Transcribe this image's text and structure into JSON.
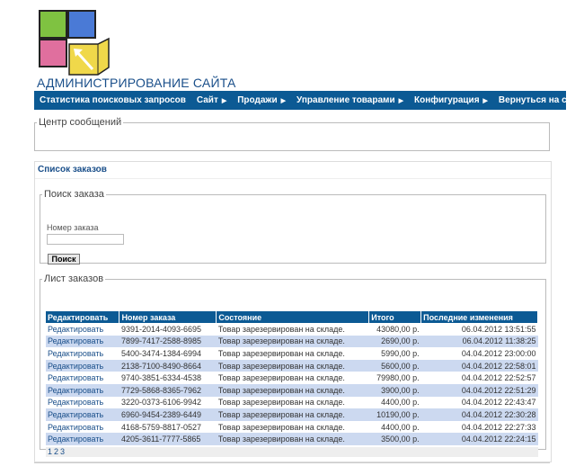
{
  "header": {
    "site_title": "АДМИНИСТРИРОВАНИЕ САЙТА",
    "logo_colors": [
      "#7fc241",
      "#4a7ad6",
      "#e06f9e",
      "#f0d84a"
    ]
  },
  "nav": {
    "items": [
      {
        "label": "Статистика поисковых запросов",
        "submenu": false
      },
      {
        "label": "Сайт",
        "submenu": true
      },
      {
        "label": "Продажи",
        "submenu": true
      },
      {
        "label": "Управление товарами",
        "submenu": true
      },
      {
        "label": "Конфигурация",
        "submenu": true
      },
      {
        "label": "Вернуться на сайт",
        "submenu": false
      }
    ],
    "arrow": "▶"
  },
  "message_center": {
    "legend": "Центр сообщений"
  },
  "orders_panel": {
    "title": "Список заказов",
    "search": {
      "legend": "Поиск заказа",
      "field_label": "Номер заказа",
      "field_value": "",
      "button": "Поиск"
    },
    "list": {
      "legend": "Лист заказов",
      "columns": [
        "Редактировать",
        "Номер заказа",
        "Состояние",
        "Итого",
        "Последние изменения"
      ],
      "rows": [
        [
          "Редактировать",
          "9391-2014-4093-6695",
          "Товар зарезервирован на складе.",
          "43080,00 р.",
          "06.04.2012 13:51:55"
        ],
        [
          "Редактировать",
          "7899-7417-2588-8985",
          "Товар зарезервирован на складе.",
          "2690,00 р.",
          "06.04.2012 11:38:25"
        ],
        [
          "Редактировать",
          "5400-3474-1384-6994",
          "Товар зарезервирован на складе.",
          "5990,00 р.",
          "04.04.2012 23:00:00"
        ],
        [
          "Редактировать",
          "2138-7100-8490-8664",
          "Товар зарезервирован на складе.",
          "5600,00 р.",
          "04.04.2012 22:58:01"
        ],
        [
          "Редактировать",
          "9740-3851-6334-4538",
          "Товар зарезервирован на складе.",
          "79980,00 р.",
          "04.04.2012 22:52:57"
        ],
        [
          "Редактировать",
          "7729-5868-8365-7962",
          "Товар зарезервирован на складе.",
          "3900,00 р.",
          "04.04.2012 22:51:29"
        ],
        [
          "Редактировать",
          "3220-0373-6106-9942",
          "Товар зарезервирован на складе.",
          "4400,00 р.",
          "04.04.2012 22:43:47"
        ],
        [
          "Редактировать",
          "6960-9454-2389-6449",
          "Товар зарезервирован на складе.",
          "10190,00 р.",
          "04.04.2012 22:30:28"
        ],
        [
          "Редактировать",
          "4168-5759-8817-0527",
          "Товар зарезервирован на складе.",
          "4400,00 р.",
          "04.04.2012 22:27:33"
        ],
        [
          "Редактировать",
          "4205-3611-7777-5865",
          "Товар зарезервирован на складе.",
          "3500,00 р.",
          "04.04.2012 22:24:15"
        ]
      ],
      "pages": [
        "1",
        "2",
        "3"
      ]
    }
  }
}
